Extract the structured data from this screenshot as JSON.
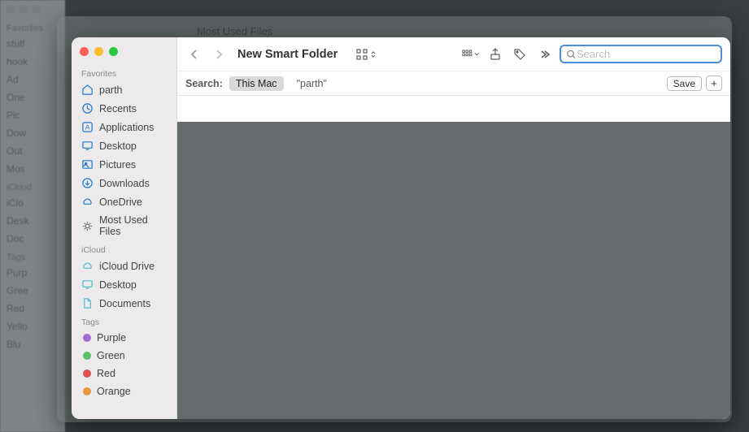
{
  "window": {
    "title": "New Smart Folder",
    "search_placeholder": "Search"
  },
  "scope": {
    "label": "Search:",
    "options": [
      "This Mac",
      "\"parth\""
    ],
    "active": 0,
    "save_label": "Save"
  },
  "sidebar": {
    "sections": [
      {
        "title": "Favorites",
        "items": [
          {
            "icon": "home-icon",
            "label": "parth",
            "color": "#1f78d1"
          },
          {
            "icon": "clock-icon",
            "label": "Recents",
            "color": "#1f78d1"
          },
          {
            "icon": "app-icon",
            "label": "Applications",
            "color": "#1f78d1"
          },
          {
            "icon": "desktop-icon",
            "label": "Desktop",
            "color": "#1f78d1"
          },
          {
            "icon": "pictures-icon",
            "label": "Pictures",
            "color": "#1f78d1"
          },
          {
            "icon": "downloads-icon",
            "label": "Downloads",
            "color": "#1f78d1"
          },
          {
            "icon": "cloud-icon",
            "label": "OneDrive",
            "color": "#1f78d1"
          },
          {
            "icon": "gear-icon",
            "label": "Most Used Files",
            "color": "#1f78d1"
          }
        ]
      },
      {
        "title": "iCloud",
        "items": [
          {
            "icon": "cloud-icon",
            "label": "iCloud Drive",
            "color": "#4fb9d6"
          },
          {
            "icon": "desktop-icon",
            "label": "Desktop",
            "color": "#4fb9d6"
          },
          {
            "icon": "doc-icon",
            "label": "Documents",
            "color": "#4fb9d6"
          }
        ]
      },
      {
        "title": "Tags",
        "items": [
          {
            "icon": "tag-dot",
            "label": "Purple",
            "color": "#a26bd6"
          },
          {
            "icon": "tag-dot",
            "label": "Green",
            "color": "#5bbf63"
          },
          {
            "icon": "tag-dot",
            "label": "Red",
            "color": "#e05252"
          },
          {
            "icon": "tag-dot",
            "label": "Orange",
            "color": "#e8983c"
          }
        ]
      }
    ]
  },
  "bg_sidebar": {
    "sections": [
      {
        "title": "Favorites",
        "items": [
          "stuff",
          "hook",
          "Ad",
          "One",
          "Pic",
          "Dow",
          "Out",
          "Mos"
        ]
      },
      {
        "title": "iCloud",
        "items": [
          "iClo",
          "Desk",
          "Doc"
        ]
      },
      {
        "title": "Tags",
        "items": [
          "Purp",
          "Gree",
          "Red",
          "Yello",
          "Blu"
        ]
      }
    ]
  },
  "bg_title": "Most Used Files"
}
